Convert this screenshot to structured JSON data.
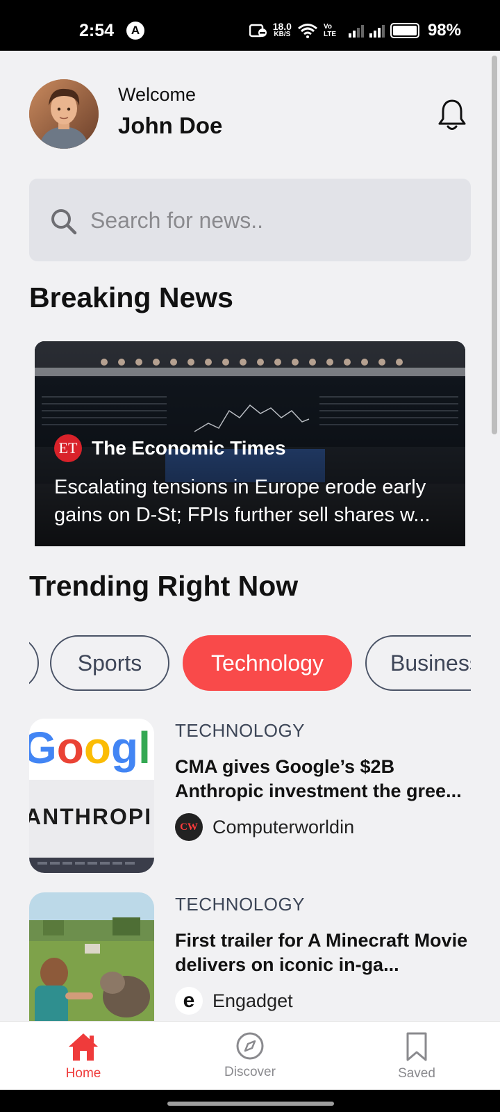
{
  "status_bar": {
    "time": "2:54",
    "net_speed_value": "18.0",
    "net_speed_unit": "KB/S",
    "volte": "Vo LTE",
    "battery": "98%"
  },
  "header": {
    "welcome": "Welcome",
    "user_name": "John Doe"
  },
  "search": {
    "placeholder": "Search for news.."
  },
  "breaking": {
    "section_title": "Breaking News",
    "source_logo": "ET",
    "source": "The Economic Times",
    "headline": "Escalating tensions in Europe erode early gains on D-St; FPIs further sell shares w..."
  },
  "trending": {
    "section_title": "Trending Right Now",
    "categories": [
      "Sports",
      "Technology",
      "Business"
    ],
    "active_category": "Technology"
  },
  "news": [
    {
      "category": "TECHNOLOGY",
      "title": "CMA gives Google’s $2B Anthropic investment the gree...",
      "source": "Computerworldin",
      "thumb_text_top": "Googl",
      "thumb_text_bottom": "ANTHROPI",
      "source_logo": "CW"
    },
    {
      "category": "TECHNOLOGY",
      "title": "First trailer for A Minecraft Movie delivers on iconic in-ga...",
      "source": "Engadget",
      "source_logo": "e"
    }
  ],
  "nav": [
    {
      "label": "Home",
      "icon": "home-icon",
      "active": true
    },
    {
      "label": "Discover",
      "icon": "compass-icon",
      "active": false
    },
    {
      "label": "Saved",
      "icon": "bookmark-icon",
      "active": false
    }
  ],
  "colors": {
    "accent": "#f94a4a",
    "background": "#f1f1f3",
    "search_bg": "#e2e3e8"
  }
}
